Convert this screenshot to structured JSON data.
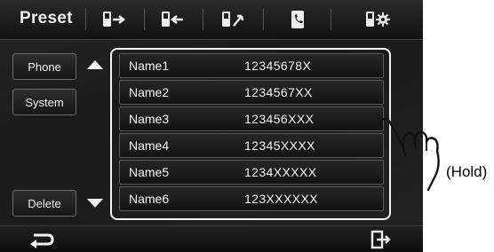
{
  "header": {
    "title": "Preset"
  },
  "toolbar": [
    {
      "name": "transfer-out-icon"
    },
    {
      "name": "transfer-in-icon"
    },
    {
      "name": "edit-entry-icon"
    },
    {
      "name": "phonebook-icon"
    },
    {
      "name": "phone-settings-icon"
    }
  ],
  "sidebar": {
    "phone_label": "Phone",
    "system_label": "System",
    "delete_label": "Delete"
  },
  "list": {
    "items": [
      {
        "name": "Name1",
        "number": "12345678X"
      },
      {
        "name": "Name2",
        "number": "1234567XX"
      },
      {
        "name": "Name3",
        "number": "123456XXX"
      },
      {
        "name": "Name4",
        "number": "12345XXXX"
      },
      {
        "name": "Name5",
        "number": "1234XXXXX"
      },
      {
        "name": "Name6",
        "number": "123XXXXXX"
      }
    ]
  },
  "annotation": {
    "hold_label": "(Hold)"
  },
  "colors": {
    "background": "#1a1a1a",
    "text": "#f5f5f5",
    "border": "#f4f4f4"
  }
}
